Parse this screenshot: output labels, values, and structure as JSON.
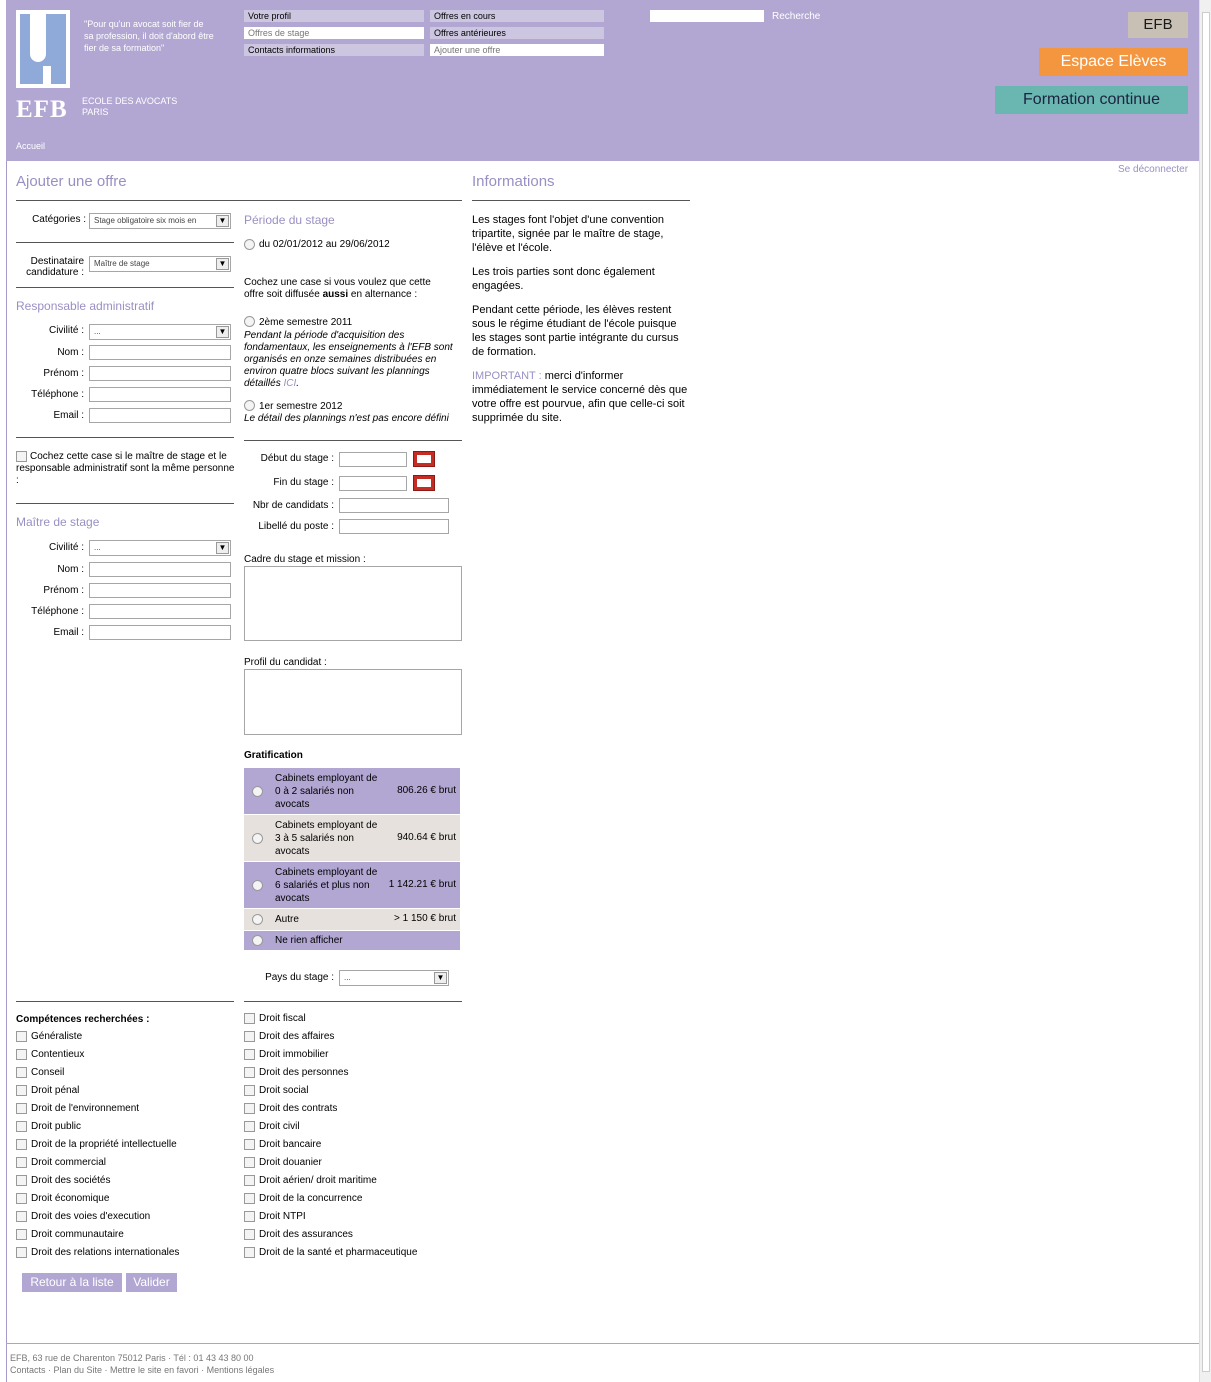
{
  "header": {
    "quote": "\"Pour qu'un avocat soit fier de sa profession, il doit d'abord être fier de sa formation\"",
    "logo_text": "EFB",
    "school_line1": "ECOLE DES AVOCATS",
    "school_line2": "PARIS",
    "breadcrumb": "Accueil",
    "nav": [
      "Votre profil",
      "Offres en cours",
      "Offres de stage",
      "Offres antérieures",
      "Contacts informations",
      "Ajouter une offre"
    ],
    "search_label": "Recherche",
    "btn_efb": "EFB",
    "btn_eleves": "Espace Elèves",
    "btn_formation": "Formation continue",
    "logout": "Se déconnecter"
  },
  "form": {
    "title": "Ajouter une offre",
    "categories_label": "Catégories :",
    "categories_value": "Stage obligatoire six mois en",
    "destinataire_label1": "Destinataire",
    "destinataire_label2": "candidature :",
    "destinataire_value": "Maître de stage",
    "resp_title": "Responsable administratif",
    "civilite": "Civilité :",
    "civilite_value": "...",
    "nom": "Nom :",
    "prenom": "Prénom :",
    "telephone": "Téléphone :",
    "email": "Email :",
    "same_person": "Cochez cette case si le maître de stage et le responsable administratif sont la même personne :",
    "maitre_title": "Maître de stage",
    "periode_title": "Période du stage",
    "periode_option": "du 02/01/2012 au 29/06/2012",
    "alternance_text1": "Cochez une case si vous voulez que cette",
    "alternance_text2a": "offre soit diffusée ",
    "alternance_text2b": "aussi",
    "alternance_text2c": " en alternance :",
    "sem1_label": "2ème semestre 2011",
    "sem1_desc": "Pendant la période d'acquisition des fondamentaux, les enseignements à l'EFB sont organisés en onze semaines distribuées en environ quatre blocs suivant les plannings détaillés ",
    "sem1_link": "ICI",
    "sem2_label": "1er semestre 2012",
    "sem2_desc": "Le détail des plannings n'est pas encore défini",
    "debut": "Début du stage :",
    "fin": "Fin du stage :",
    "nbr": "Nbr de candidats :",
    "libelle": "Libellé du poste :",
    "cadre": "Cadre du stage et mission :",
    "profil": "Profil du candidat :",
    "gratification_title": "Gratification",
    "pays_label": "Pays du stage :",
    "pays_value": "..."
  },
  "gratification": [
    {
      "desc": "Cabinets employant de 0 à 2 salariés non avocats",
      "amount": "806.26 € brut"
    },
    {
      "desc": "Cabinets employant de 3 à 5 salariés non avocats",
      "amount": "940.64 € brut"
    },
    {
      "desc": "Cabinets employant de 6 salariés et plus non avocats",
      "amount": "1 142.21 € brut"
    },
    {
      "desc": "Autre",
      "amount": "> 1 150 € brut"
    },
    {
      "desc": "Ne rien afficher",
      "amount": ""
    }
  ],
  "competences_title": "Compétences recherchées :",
  "competences_left": [
    "Généraliste",
    "Contentieux",
    "Conseil",
    "Droit pénal",
    "Droit de l'environnement",
    "Droit public",
    "Droit de la propriété intellectuelle",
    "Droit commercial",
    "Droit des sociétés",
    "Droit économique",
    "Droit des voies d'execution",
    "Droit communautaire",
    "Droit des relations internationales"
  ],
  "competences_right": [
    "Droit fiscal",
    "Droit des affaires",
    "Droit immobilier",
    "Droit des personnes",
    "Droit social",
    "Droit des contrats",
    "Droit civil",
    "Droit bancaire",
    "Droit douanier",
    "Droit aérien/ droit maritime",
    "Droit de la concurrence",
    "Droit NTPI",
    "Droit des assurances",
    "Droit de la santé et pharmaceutique"
  ],
  "buttons": {
    "retour": "Retour à la liste",
    "valider": "Valider"
  },
  "info": {
    "title": "Informations",
    "p1": "Les stages font l'objet d'une convention tripartite, signée par le maître de stage, l'élève et l'école.",
    "p2": "Les trois parties sont donc également engagées.",
    "p3": "Pendant cette période, les élèves restent sous le régime étudiant de l'école puisque les stages sont partie intégrante du cursus de formation.",
    "p4_label": "IMPORTANT :",
    "p4": " merci d'informer immédiatement le service concerné dès que votre offre est pourvue, afin que celle-ci soit supprimée du site."
  },
  "footer": {
    "line1": "EFB, 63 rue de Charenton 75012 Paris · Tél : 01 43 43 80 00",
    "line2": "Contacts · Plan du Site · Mettre le site en favori · Mentions légales"
  }
}
